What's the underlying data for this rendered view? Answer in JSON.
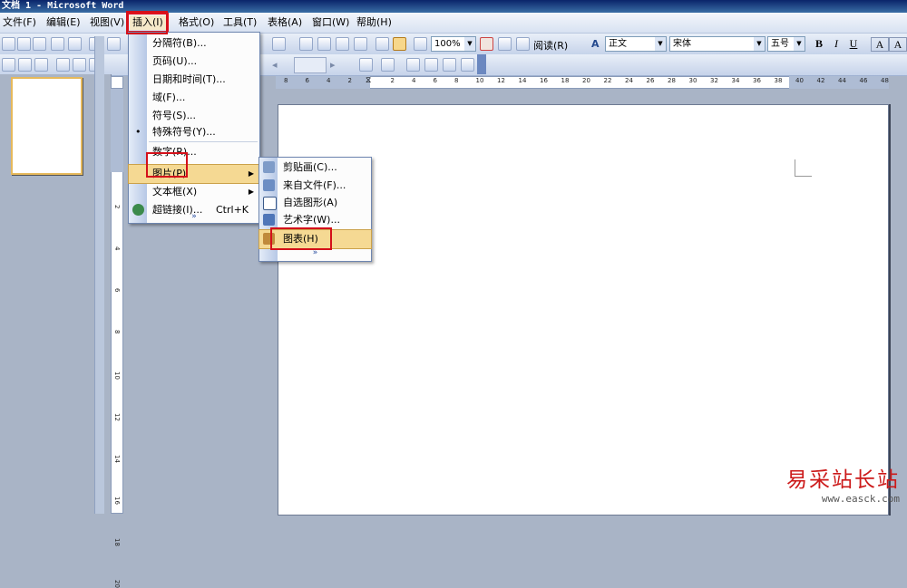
{
  "window": {
    "title": "文档 1 - Microsoft Word"
  },
  "menubar": {
    "items": [
      "文件(F)",
      "编辑(E)",
      "视图(V)",
      "插入(I)",
      "格式(O)",
      "工具(T)",
      "表格(A)",
      "窗口(W)",
      "帮助(H)"
    ],
    "active_index": 3
  },
  "toolbar": {
    "zoom": "100%",
    "read_label": "阅读(R)",
    "style": "正文",
    "font": "宋体",
    "size": "五号",
    "bold": "B",
    "italic": "I",
    "underline": "U",
    "font_color": "A"
  },
  "hruler": {
    "numbers": [
      "8",
      "6",
      "4",
      "2",
      "",
      "2",
      "4",
      "6",
      "8",
      "10",
      "12",
      "14",
      "16",
      "18",
      "20",
      "22",
      "24",
      "26",
      "28",
      "30",
      "32",
      "34",
      "36",
      "38",
      "40",
      "42",
      "44",
      "46",
      "48"
    ]
  },
  "vruler": {
    "numbers": [
      "2",
      "4",
      "6",
      "8",
      "10",
      "12",
      "14",
      "16",
      "18",
      "20"
    ]
  },
  "insert_menu": {
    "items": [
      {
        "label": "分隔符(B)...",
        "has_submenu": false
      },
      {
        "label": "页码(U)...",
        "has_submenu": false
      },
      {
        "label": "日期和时间(T)...",
        "has_submenu": false
      },
      {
        "label": "域(F)...",
        "has_submenu": false
      },
      {
        "label": "符号(S)...",
        "has_submenu": false
      },
      {
        "label": "特殊符号(Y)...",
        "has_submenu": false
      },
      {
        "label": "数字(R)...",
        "has_submenu": false
      },
      {
        "label": "图片(P)",
        "has_submenu": true,
        "selected": true
      },
      {
        "label": "文本框(X)",
        "has_submenu": true
      },
      {
        "label": "超链接(I)...",
        "accel": "Ctrl+K",
        "has_submenu": false
      }
    ],
    "expand": "»"
  },
  "picture_submenu": {
    "items": [
      {
        "label": "剪贴画(C)..."
      },
      {
        "label": "来自文件(F)..."
      },
      {
        "label": "自选图形(A)"
      },
      {
        "label": "艺术字(W)..."
      },
      {
        "label": "图表(H)",
        "selected": true
      }
    ],
    "expand": "»"
  },
  "watermark": {
    "text": "易采站长站",
    "url": "www.easck.com"
  },
  "colors": {
    "highlight": "#f5d993",
    "annotation": "#d4101a",
    "titlebar": "#0a246a"
  }
}
